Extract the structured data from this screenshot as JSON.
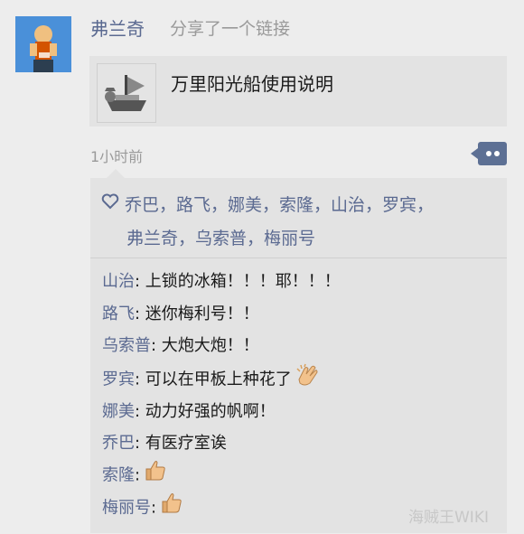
{
  "post": {
    "author": "弗兰奇",
    "action": "分享了一个链接",
    "link_title": "万里阳光船使用说明",
    "timestamp": "1小时前"
  },
  "likes": {
    "line1": "乔巴，路飞，娜美，索隆，山治，罗宾，",
    "line2": "弗兰奇，乌索普，梅丽号"
  },
  "comments": [
    {
      "name": "山治",
      "text": ": 上锁的冰箱！！！耶！！！"
    },
    {
      "name": "路飞",
      "text": ": 迷你梅利号！！"
    },
    {
      "name": "乌索普",
      "text": ": 大炮大炮！！"
    },
    {
      "name": "罗宾",
      "text": ": 可以在甲板上种花了",
      "emoji": "clapping-hands-icon"
    },
    {
      "name": "娜美",
      "text": ": 动力好强的帆啊！"
    },
    {
      "name": "乔巴",
      "text": ": 有医疗室诶"
    },
    {
      "name": "索隆",
      "text": ":",
      "emoji": "thumbs-up-icon"
    },
    {
      "name": "梅丽号",
      "text": ":",
      "emoji": "thumbs-up-icon"
    }
  ],
  "watermark": "海贼王WIKI",
  "colors": {
    "name_link": "#5b6a91",
    "panel": "#e3e3e3",
    "background": "#ededed",
    "more_button": "#5d7094"
  }
}
